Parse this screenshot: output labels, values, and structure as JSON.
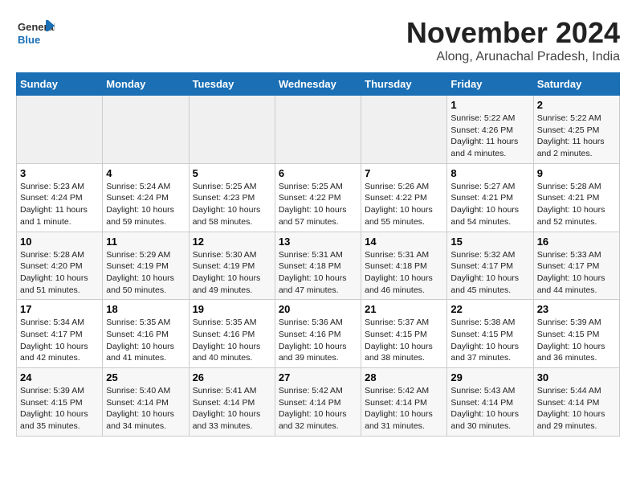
{
  "header": {
    "logo": {
      "general": "General",
      "blue": "Blue"
    },
    "title": "November 2024",
    "location": "Along, Arunachal Pradesh, India"
  },
  "calendar": {
    "days_of_week": [
      "Sunday",
      "Monday",
      "Tuesday",
      "Wednesday",
      "Thursday",
      "Friday",
      "Saturday"
    ],
    "weeks": [
      {
        "days": [
          {
            "empty": true
          },
          {
            "empty": true
          },
          {
            "empty": true
          },
          {
            "empty": true
          },
          {
            "empty": true
          },
          {
            "date": "1",
            "sunrise": "Sunrise: 5:22 AM",
            "sunset": "Sunset: 4:26 PM",
            "daylight": "Daylight: 11 hours and 4 minutes."
          },
          {
            "date": "2",
            "sunrise": "Sunrise: 5:22 AM",
            "sunset": "Sunset: 4:25 PM",
            "daylight": "Daylight: 11 hours and 2 minutes."
          }
        ]
      },
      {
        "days": [
          {
            "date": "3",
            "sunrise": "Sunrise: 5:23 AM",
            "sunset": "Sunset: 4:24 PM",
            "daylight": "Daylight: 11 hours and 1 minute."
          },
          {
            "date": "4",
            "sunrise": "Sunrise: 5:24 AM",
            "sunset": "Sunset: 4:24 PM",
            "daylight": "Daylight: 10 hours and 59 minutes."
          },
          {
            "date": "5",
            "sunrise": "Sunrise: 5:25 AM",
            "sunset": "Sunset: 4:23 PM",
            "daylight": "Daylight: 10 hours and 58 minutes."
          },
          {
            "date": "6",
            "sunrise": "Sunrise: 5:25 AM",
            "sunset": "Sunset: 4:22 PM",
            "daylight": "Daylight: 10 hours and 57 minutes."
          },
          {
            "date": "7",
            "sunrise": "Sunrise: 5:26 AM",
            "sunset": "Sunset: 4:22 PM",
            "daylight": "Daylight: 10 hours and 55 minutes."
          },
          {
            "date": "8",
            "sunrise": "Sunrise: 5:27 AM",
            "sunset": "Sunset: 4:21 PM",
            "daylight": "Daylight: 10 hours and 54 minutes."
          },
          {
            "date": "9",
            "sunrise": "Sunrise: 5:28 AM",
            "sunset": "Sunset: 4:21 PM",
            "daylight": "Daylight: 10 hours and 52 minutes."
          }
        ]
      },
      {
        "days": [
          {
            "date": "10",
            "sunrise": "Sunrise: 5:28 AM",
            "sunset": "Sunset: 4:20 PM",
            "daylight": "Daylight: 10 hours and 51 minutes."
          },
          {
            "date": "11",
            "sunrise": "Sunrise: 5:29 AM",
            "sunset": "Sunset: 4:19 PM",
            "daylight": "Daylight: 10 hours and 50 minutes."
          },
          {
            "date": "12",
            "sunrise": "Sunrise: 5:30 AM",
            "sunset": "Sunset: 4:19 PM",
            "daylight": "Daylight: 10 hours and 49 minutes."
          },
          {
            "date": "13",
            "sunrise": "Sunrise: 5:31 AM",
            "sunset": "Sunset: 4:18 PM",
            "daylight": "Daylight: 10 hours and 47 minutes."
          },
          {
            "date": "14",
            "sunrise": "Sunrise: 5:31 AM",
            "sunset": "Sunset: 4:18 PM",
            "daylight": "Daylight: 10 hours and 46 minutes."
          },
          {
            "date": "15",
            "sunrise": "Sunrise: 5:32 AM",
            "sunset": "Sunset: 4:17 PM",
            "daylight": "Daylight: 10 hours and 45 minutes."
          },
          {
            "date": "16",
            "sunrise": "Sunrise: 5:33 AM",
            "sunset": "Sunset: 4:17 PM",
            "daylight": "Daylight: 10 hours and 44 minutes."
          }
        ]
      },
      {
        "days": [
          {
            "date": "17",
            "sunrise": "Sunrise: 5:34 AM",
            "sunset": "Sunset: 4:17 PM",
            "daylight": "Daylight: 10 hours and 42 minutes."
          },
          {
            "date": "18",
            "sunrise": "Sunrise: 5:35 AM",
            "sunset": "Sunset: 4:16 PM",
            "daylight": "Daylight: 10 hours and 41 minutes."
          },
          {
            "date": "19",
            "sunrise": "Sunrise: 5:35 AM",
            "sunset": "Sunset: 4:16 PM",
            "daylight": "Daylight: 10 hours and 40 minutes."
          },
          {
            "date": "20",
            "sunrise": "Sunrise: 5:36 AM",
            "sunset": "Sunset: 4:16 PM",
            "daylight": "Daylight: 10 hours and 39 minutes."
          },
          {
            "date": "21",
            "sunrise": "Sunrise: 5:37 AM",
            "sunset": "Sunset: 4:15 PM",
            "daylight": "Daylight: 10 hours and 38 minutes."
          },
          {
            "date": "22",
            "sunrise": "Sunrise: 5:38 AM",
            "sunset": "Sunset: 4:15 PM",
            "daylight": "Daylight: 10 hours and 37 minutes."
          },
          {
            "date": "23",
            "sunrise": "Sunrise: 5:39 AM",
            "sunset": "Sunset: 4:15 PM",
            "daylight": "Daylight: 10 hours and 36 minutes."
          }
        ]
      },
      {
        "days": [
          {
            "date": "24",
            "sunrise": "Sunrise: 5:39 AM",
            "sunset": "Sunset: 4:15 PM",
            "daylight": "Daylight: 10 hours and 35 minutes."
          },
          {
            "date": "25",
            "sunrise": "Sunrise: 5:40 AM",
            "sunset": "Sunset: 4:14 PM",
            "daylight": "Daylight: 10 hours and 34 minutes."
          },
          {
            "date": "26",
            "sunrise": "Sunrise: 5:41 AM",
            "sunset": "Sunset: 4:14 PM",
            "daylight": "Daylight: 10 hours and 33 minutes."
          },
          {
            "date": "27",
            "sunrise": "Sunrise: 5:42 AM",
            "sunset": "Sunset: 4:14 PM",
            "daylight": "Daylight: 10 hours and 32 minutes."
          },
          {
            "date": "28",
            "sunrise": "Sunrise: 5:42 AM",
            "sunset": "Sunset: 4:14 PM",
            "daylight": "Daylight: 10 hours and 31 minutes."
          },
          {
            "date": "29",
            "sunrise": "Sunrise: 5:43 AM",
            "sunset": "Sunset: 4:14 PM",
            "daylight": "Daylight: 10 hours and 30 minutes."
          },
          {
            "date": "30",
            "sunrise": "Sunrise: 5:44 AM",
            "sunset": "Sunset: 4:14 PM",
            "daylight": "Daylight: 10 hours and 29 minutes."
          }
        ]
      }
    ]
  }
}
